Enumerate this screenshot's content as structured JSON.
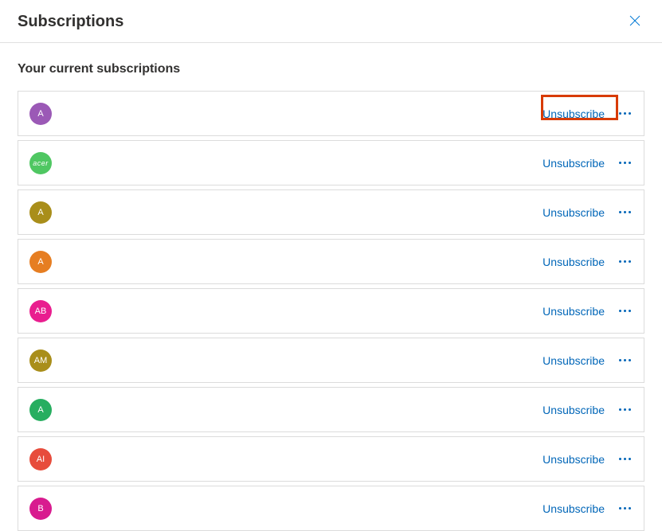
{
  "header": {
    "title": "Subscriptions"
  },
  "section": {
    "title": "Your current subscriptions"
  },
  "labels": {
    "unsubscribe": "Unsubscribe"
  },
  "subscriptions": [
    {
      "initials": "A",
      "avatar_color": "#9b59b6"
    },
    {
      "initials": "acer",
      "avatar_color": "#4fc762",
      "is_logo": true
    },
    {
      "initials": "A",
      "avatar_color": "#a98e1a"
    },
    {
      "initials": "A",
      "avatar_color": "#e67e22"
    },
    {
      "initials": "AB",
      "avatar_color": "#e91e8f"
    },
    {
      "initials": "AM",
      "avatar_color": "#a98e1a"
    },
    {
      "initials": "A",
      "avatar_color": "#27ae60"
    },
    {
      "initials": "AI",
      "avatar_color": "#e74c3c"
    },
    {
      "initials": "B",
      "avatar_color": "#d81b8f"
    }
  ],
  "highlighted_index": 0
}
